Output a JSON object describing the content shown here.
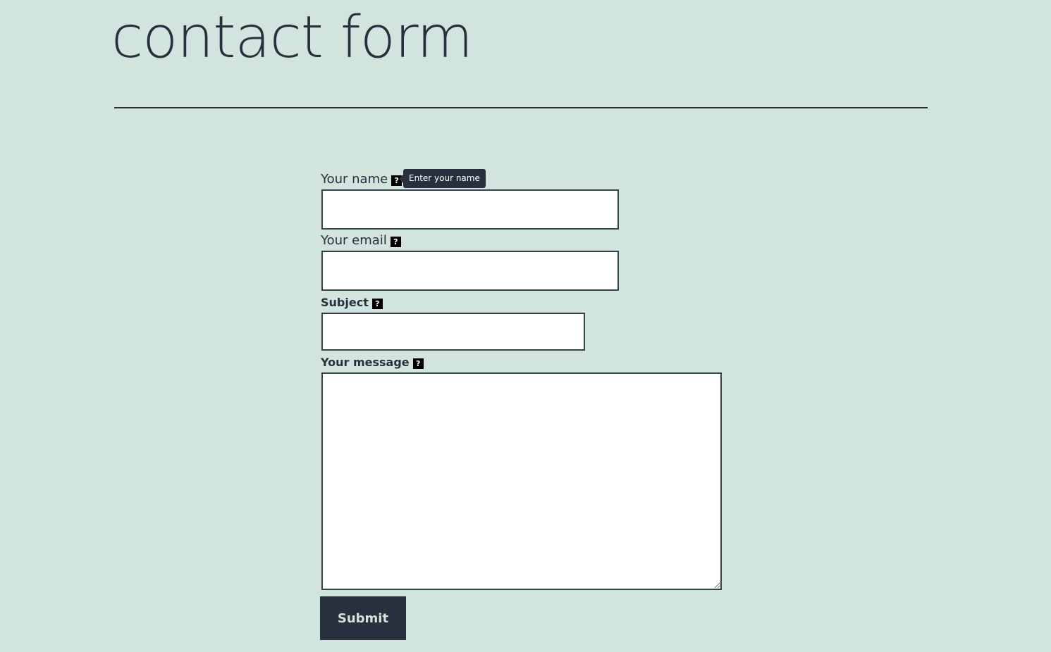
{
  "page": {
    "title": "contact form"
  },
  "form": {
    "name": {
      "label": "Your name",
      "help_icon": "question-mark-icon",
      "tooltip": "Enter your name",
      "value": ""
    },
    "email": {
      "label": "Your email",
      "help_icon": "question-mark-icon",
      "value": ""
    },
    "subject": {
      "label": "Subject",
      "help_icon": "question-mark-icon",
      "value": ""
    },
    "message": {
      "label": "Your message",
      "help_icon": "question-mark-icon",
      "value": ""
    },
    "submit_label": "Submit",
    "help_glyph": "?"
  },
  "colors": {
    "background": "#d1e4dd",
    "text": "#28303d",
    "input_border": "#39414d",
    "button_background": "#28303d",
    "button_text": "#d1e4dd"
  }
}
